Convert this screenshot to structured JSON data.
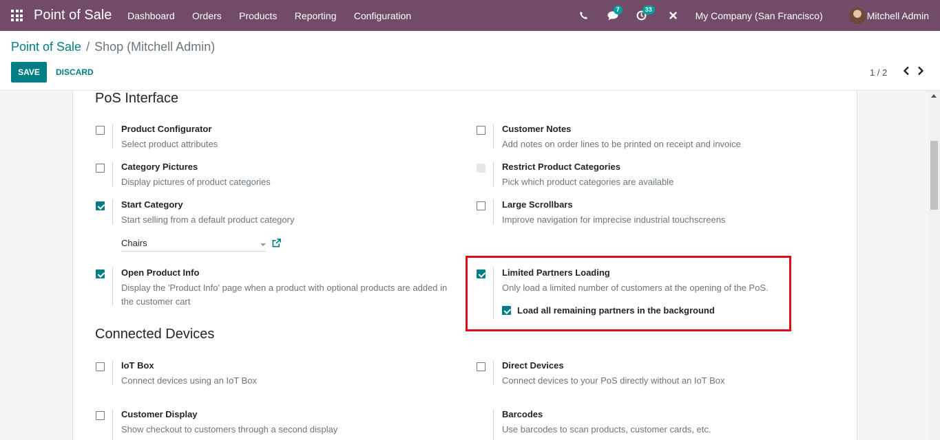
{
  "navbar": {
    "app_title": "Point of Sale",
    "menu": [
      "Dashboard",
      "Orders",
      "Products",
      "Reporting",
      "Configuration"
    ],
    "messages_count": "7",
    "activities_count": "33",
    "company": "My Company (San Francisco)",
    "user": "Mitchell Admin"
  },
  "breadcrumb": {
    "parent": "Point of Sale",
    "separator": "/",
    "current": "Shop (Mitchell Admin)"
  },
  "buttons": {
    "save": "SAVE",
    "discard": "DISCARD"
  },
  "pager": "1 / 2",
  "sections": {
    "pos_interface": "PoS Interface",
    "connected_devices": "Connected Devices"
  },
  "settings": {
    "product_configurator": {
      "label": "Product Configurator",
      "desc": "Select product attributes",
      "checked": false
    },
    "customer_notes": {
      "label": "Customer Notes",
      "desc": "Add notes on order lines to be printed on receipt and invoice",
      "checked": false
    },
    "category_pictures": {
      "label": "Category Pictures",
      "desc": "Display pictures of product categories",
      "checked": false
    },
    "restrict_categories": {
      "label": "Restrict Product Categories",
      "desc": "Pick which product categories are available",
      "checked": false,
      "disabled": true
    },
    "start_category": {
      "label": "Start Category",
      "desc": "Start selling from a default product category",
      "checked": true,
      "value": "Chairs"
    },
    "large_scrollbars": {
      "label": "Large Scrollbars",
      "desc": "Improve navigation for imprecise industrial touchscreens",
      "checked": false
    },
    "open_product_info": {
      "label": "Open Product Info",
      "desc": "Display the 'Product Info' page when a product with optional products are added in the customer cart",
      "checked": true
    },
    "limited_partners": {
      "label": "Limited Partners Loading",
      "desc": "Only load a limited number of customers at the opening of the PoS.",
      "checked": true,
      "sub_label": "Load all remaining partners in the background",
      "sub_checked": true
    },
    "iot_box": {
      "label": "IoT Box",
      "desc": "Connect devices using an IoT Box",
      "checked": false
    },
    "direct_devices": {
      "label": "Direct Devices",
      "desc": "Connect devices to your PoS directly without an IoT Box",
      "checked": false
    },
    "customer_display": {
      "label": "Customer Display",
      "desc": "Show checkout to customers through a second display",
      "checked": false
    },
    "barcodes": {
      "label": "Barcodes",
      "desc": "Use barcodes to scan products, customer cards, etc."
    }
  },
  "colors": {
    "navbar": "#714b67",
    "accent": "#017e84",
    "highlight": "#e00b1a"
  },
  "icons": [
    "apps-grid-icon",
    "phone-icon",
    "chat-icon",
    "clock-icon",
    "close-icon",
    "chevron-left-icon",
    "chevron-right-icon",
    "external-link-icon"
  ]
}
